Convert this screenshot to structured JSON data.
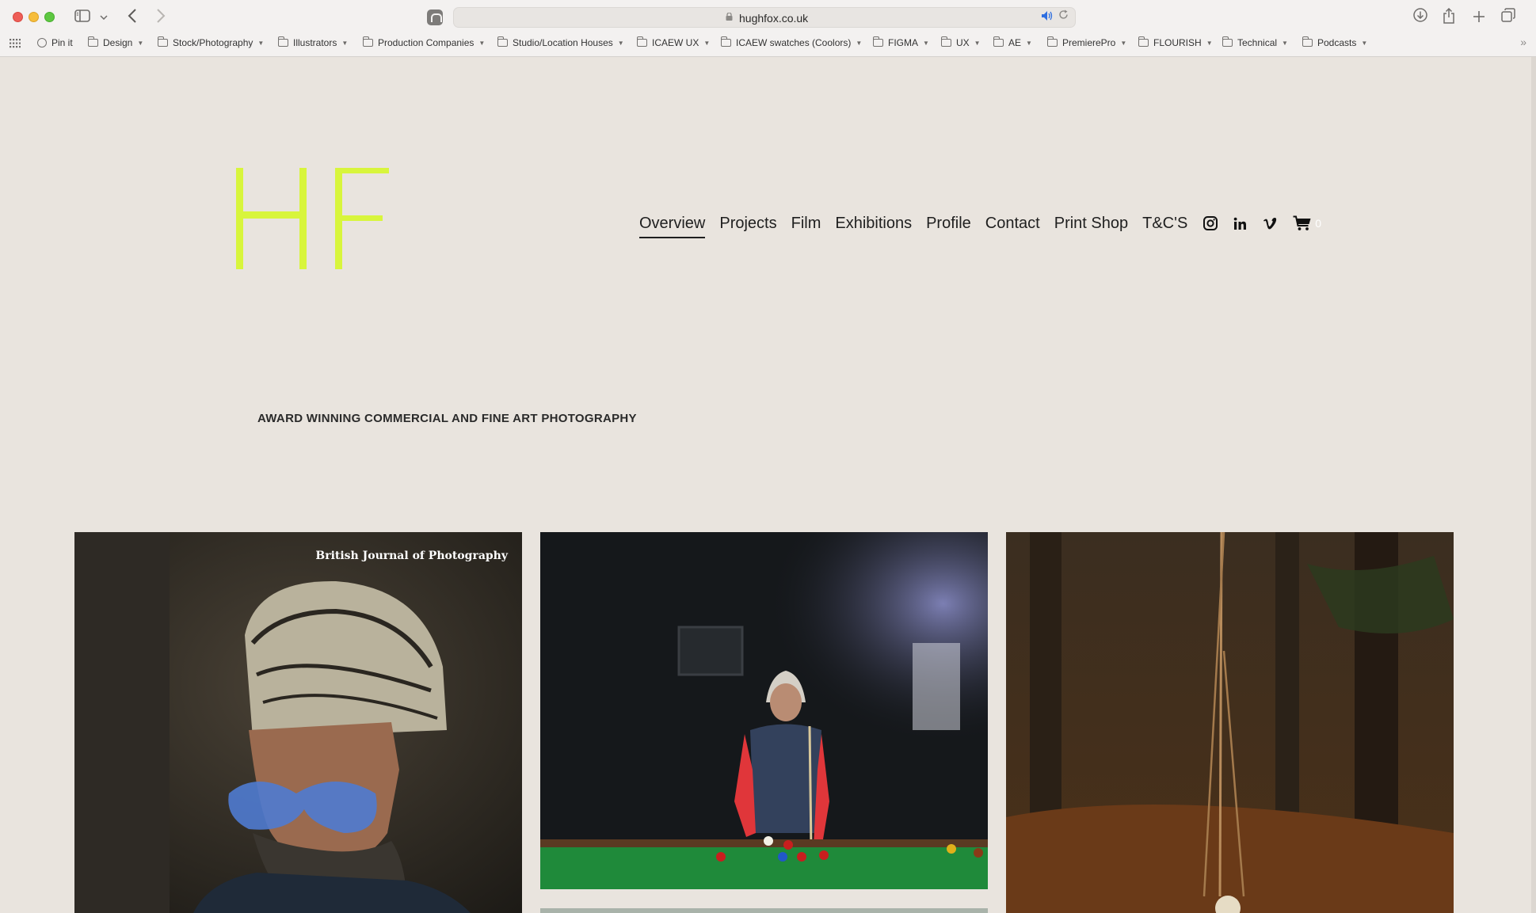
{
  "browser": {
    "url": "hughfox.co.uk",
    "bookmarks": [
      {
        "label": "Pin it",
        "type": "globe"
      },
      {
        "label": "Design",
        "type": "folder"
      },
      {
        "label": "Stock/Photography",
        "type": "folder"
      },
      {
        "label": "Illustrators",
        "type": "folder"
      },
      {
        "label": "Production Companies",
        "type": "folder"
      },
      {
        "label": "Studio/Location Houses",
        "type": "folder"
      },
      {
        "label": "ICAEW UX",
        "type": "folder"
      },
      {
        "label": "ICAEW swatches (Coolors)",
        "type": "folder"
      },
      {
        "label": "FIGMA",
        "type": "folder"
      },
      {
        "label": "UX",
        "type": "folder"
      },
      {
        "label": "AE",
        "type": "folder"
      },
      {
        "label": "PremierePro",
        "type": "folder"
      },
      {
        "label": "FLOURISH",
        "type": "folder"
      },
      {
        "label": "Technical",
        "type": "folder"
      },
      {
        "label": "Podcasts",
        "type": "folder"
      }
    ]
  },
  "site": {
    "logo_text": "HF",
    "logo_color": "#d8f53c",
    "nav": {
      "overview": "Overview",
      "projects": "Projects",
      "film": "Film",
      "exhibitions": "Exhibitions",
      "profile": "Profile",
      "contact": "Contact",
      "print_shop": "Print Shop",
      "terms": "T&C'S"
    },
    "active_nav": "Overview",
    "social_icons": [
      "instagram-icon",
      "linkedin-icon",
      "vimeo-icon"
    ],
    "cart_count": "0",
    "tagline": "AWARD WINNING COMMERCIAL AND FINE ART PHOTOGRAPHY",
    "gallery": [
      {
        "overlay_text": "British Journal of Photography"
      },
      {
        "overlay_text": ""
      },
      {
        "overlay_text": ""
      }
    ]
  }
}
